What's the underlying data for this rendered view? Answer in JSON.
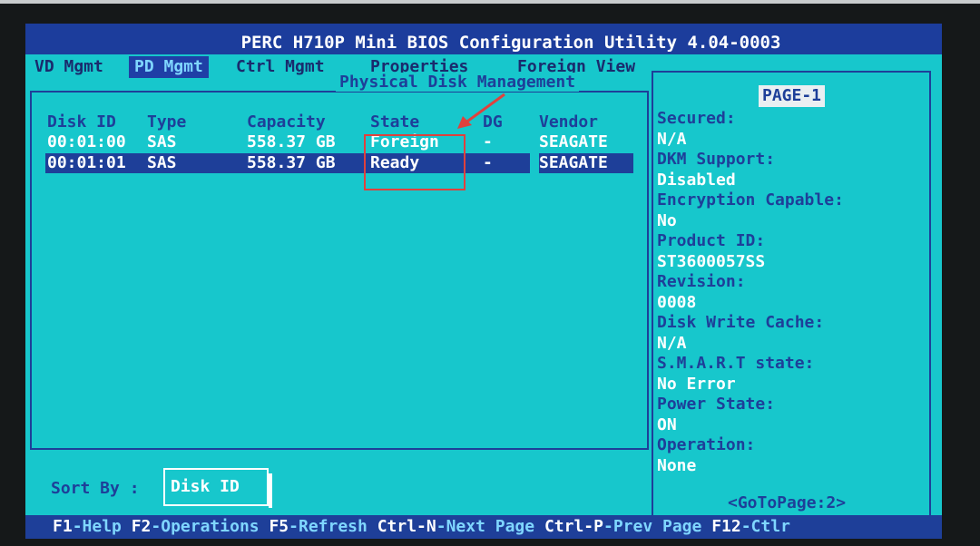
{
  "app": {
    "title": "PERC H710P Mini BIOS Configuration Utility 4.04-0003"
  },
  "tabs": [
    {
      "label": "VD Mgmt",
      "active": false
    },
    {
      "label": "PD Mgmt",
      "active": true
    },
    {
      "label": "Ctrl Mgmt",
      "active": false
    },
    {
      "label": "Properties",
      "active": false
    },
    {
      "label": "Foreign View",
      "active": false
    }
  ],
  "panel": {
    "title": "Physical Disk Management"
  },
  "table": {
    "headers": {
      "id": "Disk ID",
      "type": "Type",
      "capacity": "Capacity",
      "state": "State",
      "dg": "DG",
      "vendor": "Vendor"
    },
    "rows": [
      {
        "id": "00:01:00",
        "type": "SAS",
        "capacity": "558.37 GB",
        "state": "Foreign",
        "dg": "-",
        "vendor": "SEAGATE",
        "selected": false
      },
      {
        "id": "00:01:01",
        "type": "SAS",
        "capacity": "558.37 GB",
        "state": "Ready",
        "dg": "-",
        "vendor": "SEAGATE",
        "selected": true
      }
    ]
  },
  "sort": {
    "label": "Sort By :",
    "value": "Disk ID"
  },
  "details": {
    "page": "PAGE-1",
    "fields": [
      {
        "label": "Secured:",
        "value": "N/A"
      },
      {
        "label": "DKM Support:",
        "value": "Disabled"
      },
      {
        "label": "Encryption Capable:",
        "value": "No"
      },
      {
        "label": "Product ID:",
        "value": "ST3600057SS"
      },
      {
        "label": "Revision:",
        "value": "0008"
      },
      {
        "label": "Disk Write Cache:",
        "value": "N/A"
      },
      {
        "label": "S.M.A.R.T state:",
        "value": "No Error"
      },
      {
        "label": "Power State:",
        "value": "ON"
      },
      {
        "label": "Operation:",
        "value": "None"
      }
    ],
    "goto": "<GoToPage:2>"
  },
  "footer": {
    "items": [
      {
        "key": "F1",
        "text": "-Help"
      },
      {
        "key": "F2",
        "text": "-Operations"
      },
      {
        "key": "F5",
        "text": "-Refresh"
      },
      {
        "key": "Ctrl-N",
        "text": "-Next Page"
      },
      {
        "key": "Ctrl-P",
        "text": "-Prev Page"
      },
      {
        "key": "F12",
        "text": "-Ctlr"
      }
    ]
  },
  "colors": {
    "screen": "#17c7cc",
    "navy": "#1e3f99",
    "annotation": "#e0413d"
  }
}
